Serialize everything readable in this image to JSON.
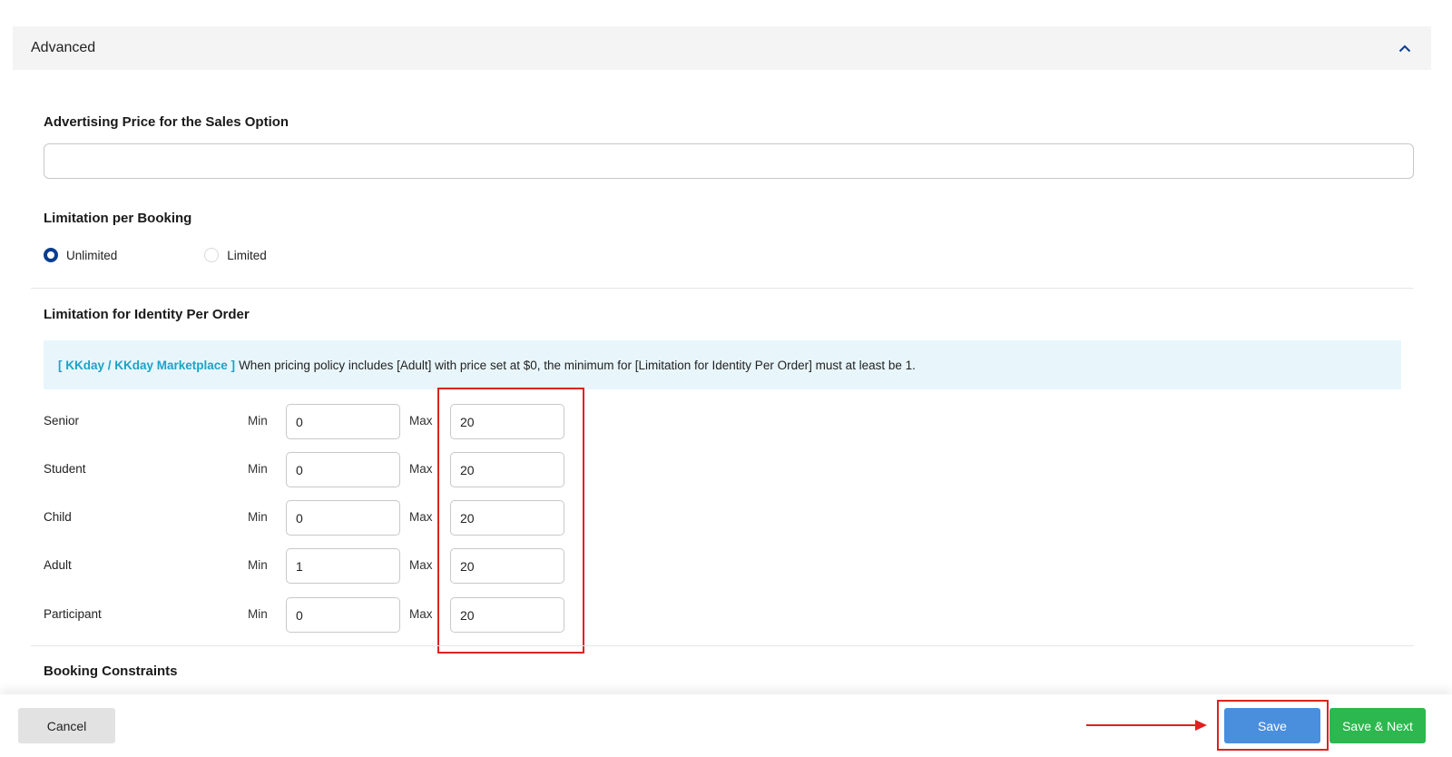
{
  "section": {
    "title": "Advanced",
    "collapse_icon": "chevron-up-icon"
  },
  "advertising_price": {
    "label": "Advertising Price for the Sales Option",
    "value": ""
  },
  "limitation_per_booking": {
    "label": "Limitation per Booking",
    "options": [
      {
        "label": "Unlimited",
        "checked": true
      },
      {
        "label": "Limited",
        "checked": false
      }
    ]
  },
  "identity_limitation": {
    "label": "Limitation for Identity Per Order",
    "notice_tag": "[ KKday / KKday Marketplace ]",
    "notice_text": "When pricing policy includes [Adult] with price set at $0, the minimum for [Limitation for Identity Per Order] must at least be 1.",
    "min_label": "Min",
    "max_label": "Max",
    "rows": [
      {
        "name": "Senior",
        "min": "0",
        "max": "20"
      },
      {
        "name": "Student",
        "min": "0",
        "max": "20"
      },
      {
        "name": "Child",
        "min": "0",
        "max": "20"
      },
      {
        "name": "Adult",
        "min": "1",
        "max": "20"
      },
      {
        "name": "Participant",
        "min": "0",
        "max": "20"
      }
    ]
  },
  "booking_constraints": {
    "label": "Booking Constraints"
  },
  "footer": {
    "cancel_label": "Cancel",
    "save_label": "Save",
    "save_next_label": "Save & Next"
  },
  "colors": {
    "primary": "#0a3d91",
    "save": "#4a8fde",
    "save_next": "#2cb84e",
    "highlight": "#e0211f",
    "notice_tag": "#1ba3c6"
  }
}
